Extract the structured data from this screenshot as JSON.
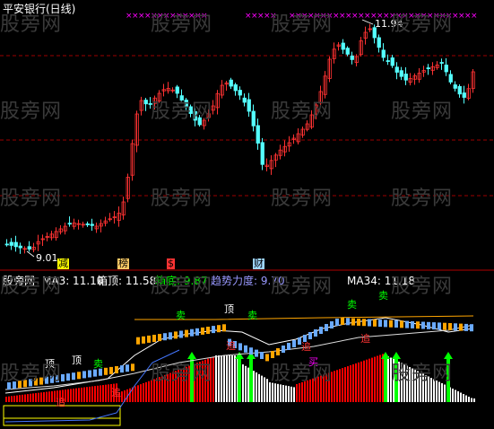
{
  "top_panel": {
    "title": "平安银行(日线)",
    "high_label": "11.94",
    "low_label": "9.01"
  },
  "signal_tags": [
    {
      "text": "减"
    },
    {
      "text": "榜"
    },
    {
      "text": "$"
    },
    {
      "text": "财"
    }
  ],
  "bottom_panel": {
    "indicator_name": "股旁网",
    "ma3": "MA3: 11.10",
    "box_top": "箱顶: 11.58",
    "box_bottom": "箱底: 9.87",
    "trend_strength": "趋势力度: 9.70",
    "ma34": "MA34: 11.18",
    "labels": [
      "顶",
      "顶",
      "卖",
      "卖",
      "顶",
      "卖",
      "卖",
      "卖",
      "追",
      "追",
      "追",
      "买",
      "追",
      "追"
    ]
  },
  "watermark": "股旁网",
  "colors": {
    "up": "#ff3232",
    "down": "#54ffff",
    "ma_white": "#ffffff",
    "x_mark": "#ff00ff",
    "hist_red": "#ff0000",
    "hist_green": "#00ff00",
    "hist_white": "#ffffff",
    "grid": "#9b0000",
    "box_line": "#ffa500"
  }
}
